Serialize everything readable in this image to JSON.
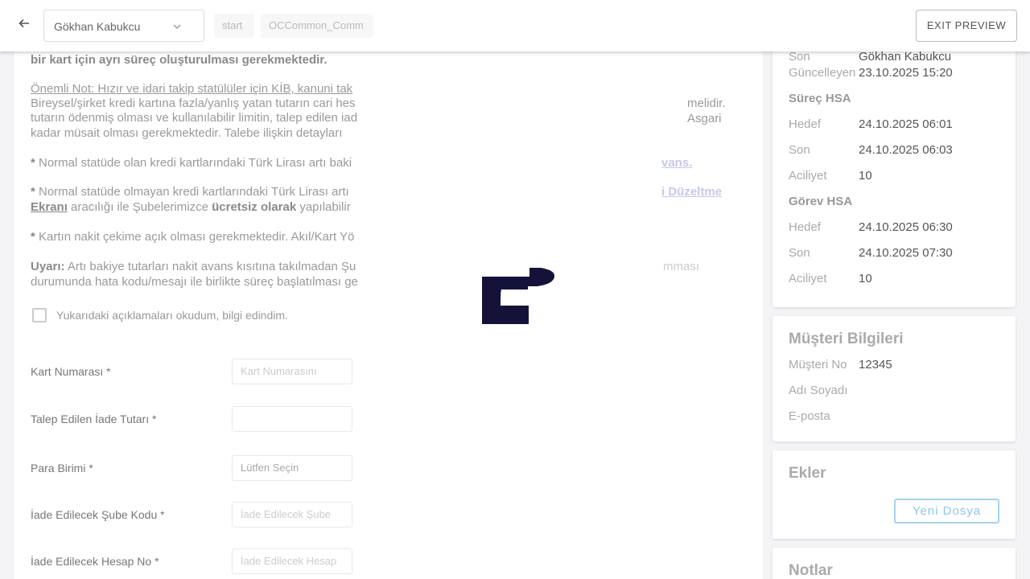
{
  "topbar": {
    "user_name": "Gökhan Kabukcu",
    "chip_start": "start",
    "chip_common": "OCCommon_Comm",
    "exit_label": "EXIT PREVIEW"
  },
  "main": {
    "line1": "bir kart için ayrı süreç oluşturulması gerekmektedir.",
    "note_prefix": "Önemli Not: Hızır ve idari takip statülüler için KİB, kanuni tak",
    "line3a": " Bireysel/şirket kredi kartına fazla/yanlış yatan tutarın cari hes",
    "line3b": "melidir. Asgari",
    "line4": "tutarın ödenmiş olması ve kullanılabilir limitin, talep edilen iad",
    "line5": " kadar müsait olması gerekmektedir. Talebe ilişkin detayları",
    "p1_bullet": " *",
    "p1_text": " Normal statüde olan kredi kartlarındaki Türk Lirası artı baki",
    "p1_right": "vans.",
    "p2_bullet": " *",
    "p2_text": " Normal statüde olmayan kredi kartlarındaki Türk Lirası artı",
    "p2_right": "i Düzeltme",
    "p2_link": "Ekranı",
    "p2_mid": " aracılığı ile Şubelerimizce ",
    "p2_bold": "ücretsiz olarak",
    "p2_end": " yapılabilir",
    "p3_bullet": " *",
    "p3_text": " Kartın nakit çekime açık olması gerekmektedir. Akıl/Kart Yö",
    "warn_label": " Uyarı:",
    "warn_text": " Artı bakiye tutarları nakit avans kısıtına takılmadan Şu",
    "warn_right": "mması",
    "warn_line2": "durumunda hata kodu/mesajı ile birlikte süreç başlatılması ge",
    "checkbox_label": "Yukarıdaki açıklamaları okudum, bilgi edindim.",
    "fields": [
      {
        "label": "Kart Numarası *",
        "placeholder": "Kart Numarasını"
      },
      {
        "label": "Talep Edilen İade Tutarı *",
        "placeholder": ""
      },
      {
        "label": "Para Birimi *",
        "placeholder": "Lütfen Seçin"
      },
      {
        "label": "İade Edilecek Şube Kodu *",
        "placeholder": "İade Edilecek Şube"
      },
      {
        "label": "İade Edilecek Hesap No *",
        "placeholder": "İade Edilecek Hesap"
      }
    ]
  },
  "process_info": {
    "last_updated_key": "Son",
    "last_updated_key2": "Güncelleyen",
    "last_updated_name": "Gökhan Kabukcu",
    "last_updated_date": "23.10.2025 15:20",
    "surec_title": "Süreç HSA",
    "surec": [
      {
        "k": "Hedef",
        "v": "24.10.2025 06:01"
      },
      {
        "k": "Son",
        "v": "24.10.2025 06:03"
      },
      {
        "k": "Aciliyet",
        "v": "10"
      }
    ],
    "gorev_title": "Görev HSA",
    "gorev": [
      {
        "k": "Hedef",
        "v": "24.10.2025 06:30"
      },
      {
        "k": "Son",
        "v": "24.10.2025 07:30"
      },
      {
        "k": "Aciliyet",
        "v": "10"
      }
    ]
  },
  "customer": {
    "title": "Müşteri Bilgileri",
    "rows": [
      {
        "k": "Müşteri No",
        "v": "12345"
      },
      {
        "k": "Adı Soyadı",
        "v": ""
      },
      {
        "k": "E-posta",
        "v": ""
      }
    ]
  },
  "attachments": {
    "title": "Ekler",
    "new_file_label": "Yeni Dosya"
  },
  "notes": {
    "title": "Notlar"
  },
  "colors": {
    "loader": "#15123a",
    "accent": "#8fc6e6"
  }
}
